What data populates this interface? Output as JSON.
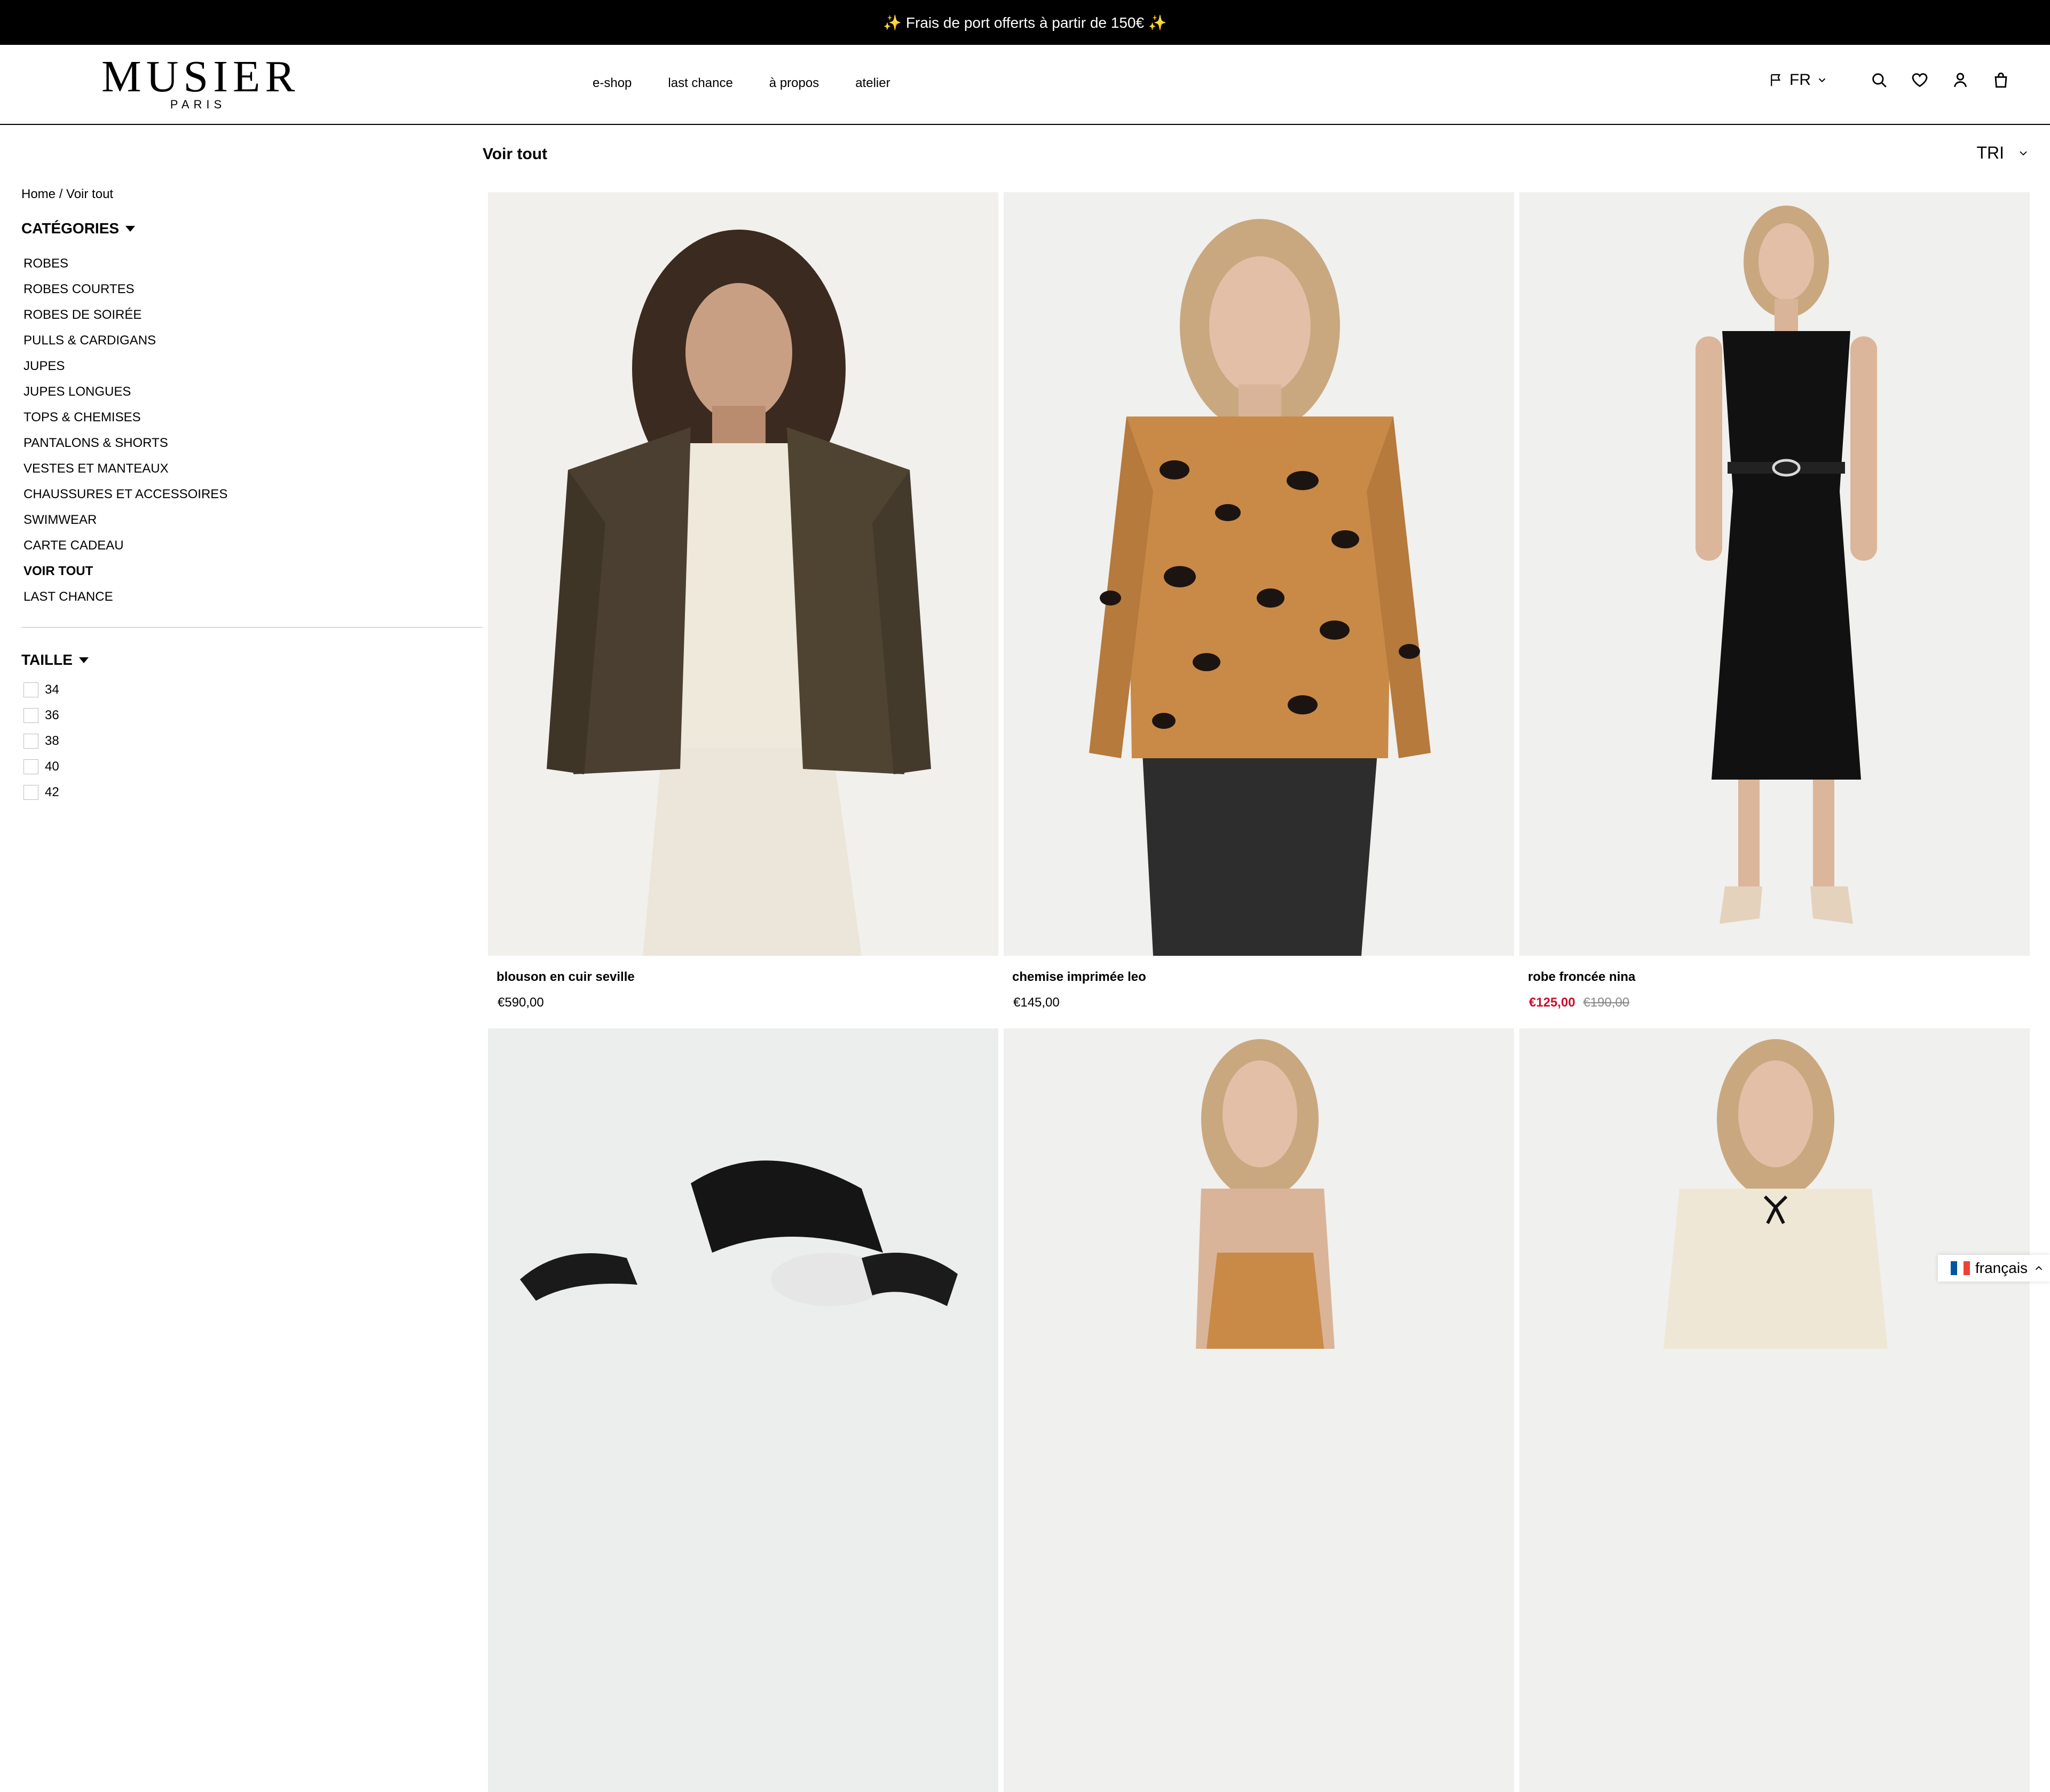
{
  "announcement": "✨ Frais de port offerts à partir de 150€ ✨",
  "brand": {
    "name": "MUSIER",
    "sub": "PARIS"
  },
  "nav": [
    "e-shop",
    "last chance",
    "à propos",
    "atelier"
  ],
  "header": {
    "language": "FR",
    "icons": [
      "flag-icon",
      "search-icon",
      "heart-icon",
      "user-icon",
      "bag-icon"
    ]
  },
  "breadcrumb": "Home / Voir tout",
  "filters": {
    "categories_title": "CATÉGORIES",
    "categories": [
      "ROBES",
      "ROBES COURTES",
      "ROBES DE SOIRÉE",
      "PULLS & CARDIGANS",
      "JUPES",
      "JUPES LONGUES",
      "TOPS & CHEMISES",
      "PANTALONS & SHORTS",
      "VESTES ET MANTEAUX",
      "CHAUSSURES ET ACCESSOIRES",
      "SWIMWEAR",
      "CARTE CADEAU",
      "VOIR TOUT",
      "LAST CHANCE"
    ],
    "active_category": "VOIR TOUT",
    "size_title": "TAILLE",
    "sizes": [
      "34",
      "36",
      "38",
      "40",
      "42"
    ]
  },
  "main": {
    "title": "Voir tout",
    "sort_label": "TRI"
  },
  "products": [
    {
      "name": "blouson en cuir seville",
      "price": "€590,00"
    },
    {
      "name": "chemise imprimée leo",
      "price": "€145,00"
    },
    {
      "name": "robe froncée nina",
      "sale_price": "€125,00",
      "old_price": "€190,00"
    }
  ],
  "language_switcher": "français",
  "colors": {
    "announcement_bg": "#000000",
    "sale": "#c8102e",
    "image_bg": "#f0f0ee"
  }
}
